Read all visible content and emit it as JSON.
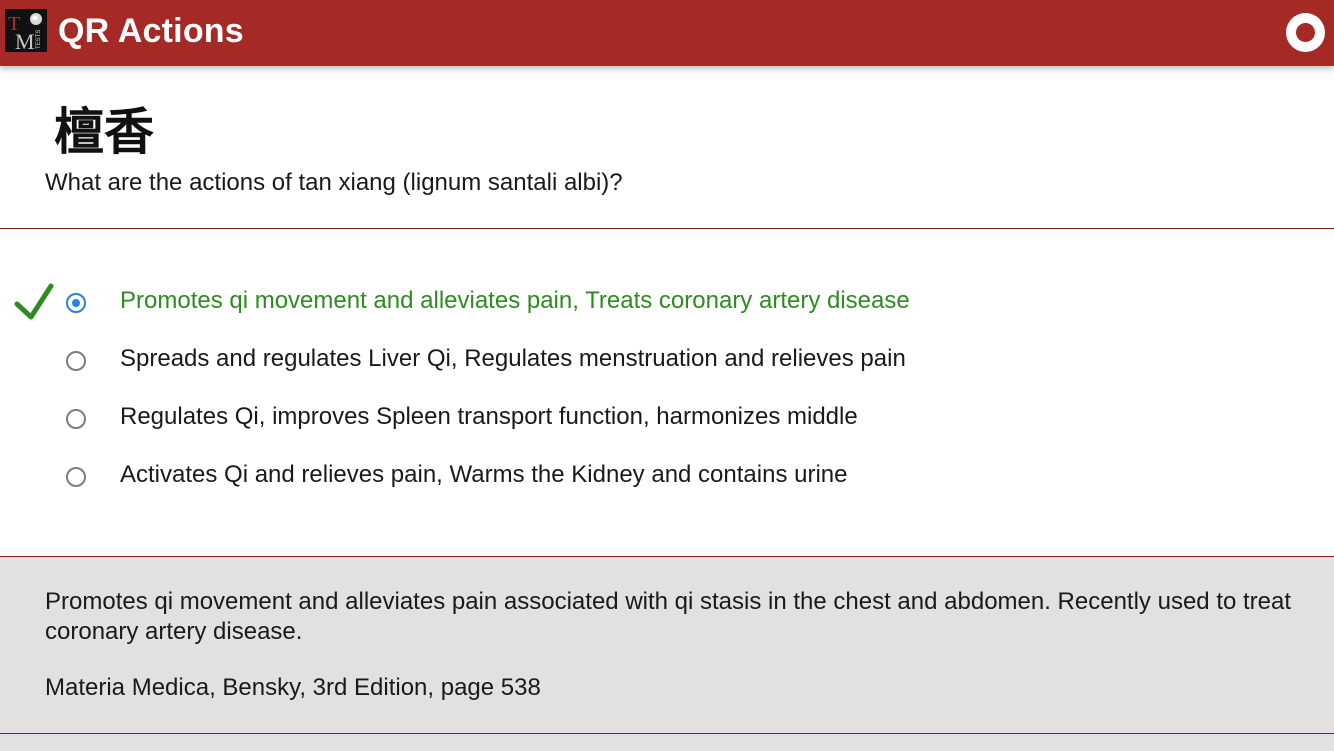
{
  "header": {
    "title": "QR Actions",
    "logo_icon": "tcm-logo-icon",
    "record_icon": "record-icon",
    "brand_color": "#a52a25"
  },
  "question": {
    "chinese": "檀香",
    "prompt": "What are the actions of tan xiang (lignum santali albi)?"
  },
  "answers": [
    {
      "label": "Promotes qi movement and alleviates pain, Treats coronary artery disease",
      "selected": true,
      "correct": true
    },
    {
      "label": "Spreads and regulates Liver Qi, Regulates menstruation and relieves pain",
      "selected": false,
      "correct": false
    },
    {
      "label": "Regulates Qi, improves Spleen transport function, harmonizes middle",
      "selected": false,
      "correct": false
    },
    {
      "label": "Activates Qi and relieves pain, Warms the Kidney and contains urine",
      "selected": false,
      "correct": false
    }
  ],
  "explanation": {
    "text": "Promotes qi movement and alleviates pain associated with qi stasis in the chest and abdomen. Recently used to treat coronary artery disease.",
    "source": "Materia Medica, Bensky, 3rd Edition, page 538"
  },
  "colors": {
    "correct_text": "#2f8a22",
    "radio_selected": "#2f7ee6",
    "divider": "#7a1f1c",
    "panel_bg": "#e1e1e1"
  }
}
